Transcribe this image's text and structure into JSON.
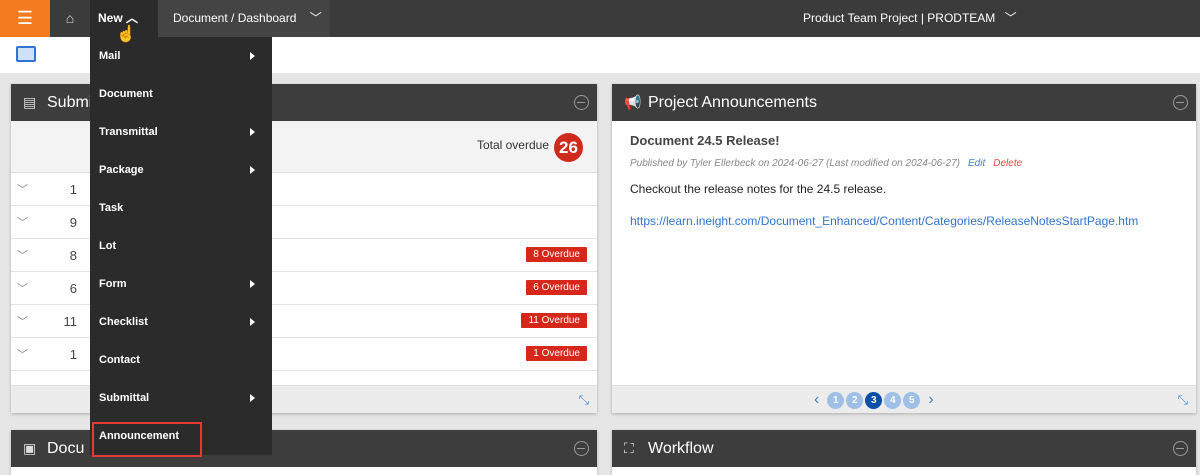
{
  "topbar": {
    "new_label": "New",
    "breadcrumb": "Document / Dashboard",
    "project": "Product Team Project | PRODTEAM"
  },
  "menu": {
    "items": [
      {
        "label": "Mail",
        "submenu": true
      },
      {
        "label": "Document",
        "submenu": false
      },
      {
        "label": "Transmittal",
        "submenu": true
      },
      {
        "label": "Package",
        "submenu": true
      },
      {
        "label": "Task",
        "submenu": false
      },
      {
        "label": "Lot",
        "submenu": false
      },
      {
        "label": "Form",
        "submenu": true
      },
      {
        "label": "Checklist",
        "submenu": true
      },
      {
        "label": "Contact",
        "submenu": false
      },
      {
        "label": "Submittal",
        "submenu": true
      },
      {
        "label": "Announcement",
        "submenu": false,
        "highlighted": true
      }
    ]
  },
  "submittals": {
    "title": "Submi",
    "total_label": "Total overdue",
    "total": "26",
    "rows": [
      {
        "count": "1",
        "badge": ""
      },
      {
        "count": "9",
        "badge": ""
      },
      {
        "count": "8",
        "badge": "8 Overdue"
      },
      {
        "count": "6",
        "badge": "6 Overdue"
      },
      {
        "count": "11",
        "badge": "11 Overdue"
      },
      {
        "count": "1",
        "badge": "1 Overdue"
      }
    ]
  },
  "announcements": {
    "title": "Project Announcements",
    "heading": "Document 24.5 Release!",
    "meta": "Published by Tyler Ellerbeck on 2024-06-27 (Last modified on 2024-06-27)",
    "edit": "Edit",
    "delete": "Delete",
    "body": "Checkout the release notes for the 24.5 release.",
    "link": "https://learn.ineight.com/Document_Enhanced/Content/Categories/ReleaseNotesStartPage.htm",
    "pages": [
      "1",
      "2",
      "3",
      "4",
      "5"
    ],
    "current_page": 3
  },
  "documents": {
    "title": "Docu"
  },
  "workflow": {
    "title": "Workflow"
  },
  "colors": {
    "accent": "#f47b20",
    "overdue": "#d7261a",
    "link": "#2f74d0"
  }
}
